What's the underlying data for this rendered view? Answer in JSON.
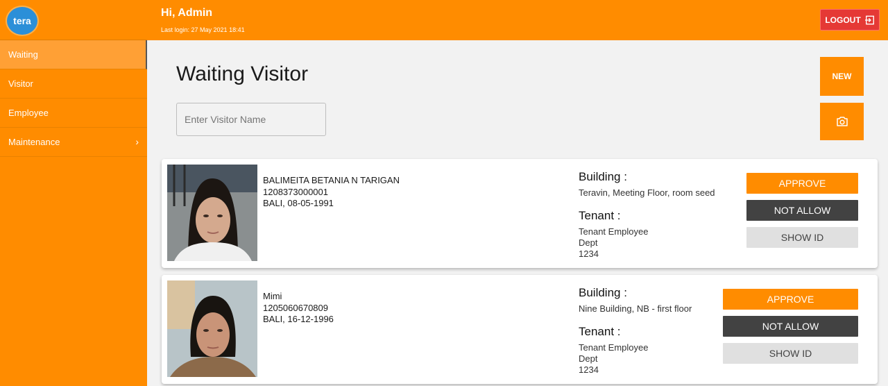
{
  "app": {
    "logo_text": "tera"
  },
  "header": {
    "greeting": "Hi, Admin",
    "last_login": "Last login: 27 May 2021 18:41",
    "logout_label": "LOGOUT"
  },
  "sidebar": {
    "items": [
      {
        "label": "Waiting",
        "active": true
      },
      {
        "label": "Visitor"
      },
      {
        "label": "Employee"
      },
      {
        "label": "Maintenance",
        "chevron": "›"
      }
    ]
  },
  "page": {
    "title": "Waiting Visitor",
    "search_placeholder": "Enter Visitor Name",
    "new_label": "NEW",
    "camera_icon": "camera-icon"
  },
  "labels": {
    "building": "Building :",
    "tenant": "Tenant :",
    "approve": "APPROVE",
    "not_allow": "NOT ALLOW",
    "show_id": "SHOW ID"
  },
  "visitors": [
    {
      "name": "BALIMEITA BETANIA N TARIGAN",
      "id_number": "1208373000001",
      "birth": "BALI, 08-05-1991",
      "building": "Teravin, Meeting Floor, room seed",
      "tenant_lines": [
        "Tenant Employee",
        "Dept",
        "1234"
      ]
    },
    {
      "name": "Mimi",
      "id_number": "1205060670809",
      "birth": "BALI, 16-12-1996",
      "building": "Nine Building, NB - first floor",
      "tenant_lines": [
        "Tenant Employee",
        "Dept",
        "1234"
      ]
    }
  ],
  "colors": {
    "accent": "#ff8c00",
    "logout": "#e53935",
    "dark_button": "#424242"
  }
}
